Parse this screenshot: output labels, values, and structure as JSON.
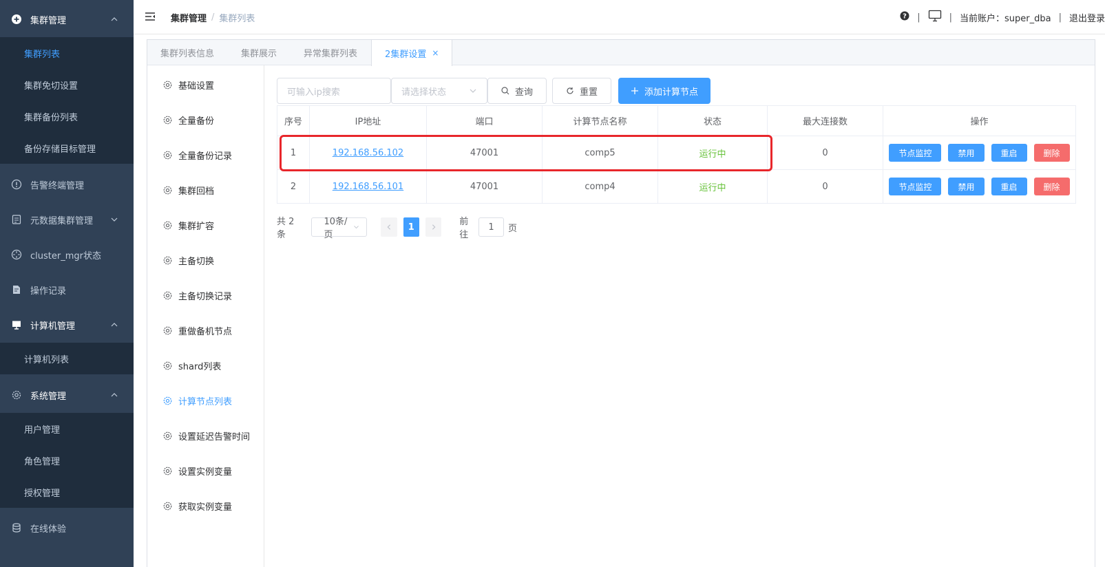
{
  "sidebar": {
    "groups": [
      {
        "label": "集群管理",
        "icon": "plus-circle-icon"
      },
      {
        "label": "告警终端管理",
        "icon": "info-circle-icon"
      },
      {
        "label": "元数据集群管理",
        "icon": "database-icon"
      },
      {
        "label": "cluster_mgr状态",
        "icon": "dashboard-icon"
      },
      {
        "label": "操作记录",
        "icon": "document-icon"
      },
      {
        "label": "计算机管理",
        "icon": "monitor-icon"
      },
      {
        "label": "系统管理",
        "icon": "gear-icon"
      },
      {
        "label": "在线体验",
        "icon": "cylinder-icon"
      }
    ],
    "cluster_sub": [
      "集群列表",
      "集群免切设置",
      "集群备份列表",
      "备份存储目标管理"
    ],
    "computer_sub": [
      "计算机列表"
    ],
    "system_sub": [
      "用户管理",
      "角色管理",
      "授权管理"
    ]
  },
  "header": {
    "breadcrumb": [
      "集群管理",
      "集群列表"
    ],
    "account_label": "当前账户：super_dba",
    "logout": "退出登录",
    "separator": "|"
  },
  "tabs": [
    {
      "label": "集群列表信息"
    },
    {
      "label": "集群展示"
    },
    {
      "label": "异常集群列表"
    },
    {
      "label": "2集群设置",
      "close": "×"
    }
  ],
  "inner_nav": [
    "基础设置",
    "全量备份",
    "全量备份记录",
    "集群回档",
    "集群扩容",
    "主备切换",
    "主备切换记录",
    "重做备机节点",
    "shard列表",
    "计算节点列表",
    "设置延迟告警时间",
    "设置实例变量",
    "获取实例变量"
  ],
  "toolbar": {
    "ip_placeholder": "可输入ip搜索",
    "status_placeholder": "请选择状态",
    "query": "查询",
    "reset": "重置",
    "add": "添加计算节点"
  },
  "table": {
    "headers": [
      "序号",
      "IP地址",
      "端口",
      "计算节点名称",
      "状态",
      "最大连接数",
      "操作"
    ],
    "rows": [
      {
        "idx": "1",
        "ip": "192.168.56.102",
        "port": "47001",
        "name": "comp5",
        "status": "运行中",
        "max": "0"
      },
      {
        "idx": "2",
        "ip": "192.168.56.101",
        "port": "47001",
        "name": "comp4",
        "status": "运行中",
        "max": "0"
      }
    ],
    "ops": [
      "节点监控",
      "禁用",
      "重启",
      "删除"
    ]
  },
  "pager": {
    "total": "共 2 条",
    "size": "10条/页",
    "current": "1",
    "goto_prefix": "前往",
    "goto_value": "1",
    "goto_suffix": "页"
  },
  "colors": {
    "sidebar_bg": "#304156",
    "submenu_bg": "#1f2d3d",
    "primary": "#409eff",
    "success": "#67c23a",
    "danger": "#f56c6c",
    "highlight": "#e8262b"
  }
}
